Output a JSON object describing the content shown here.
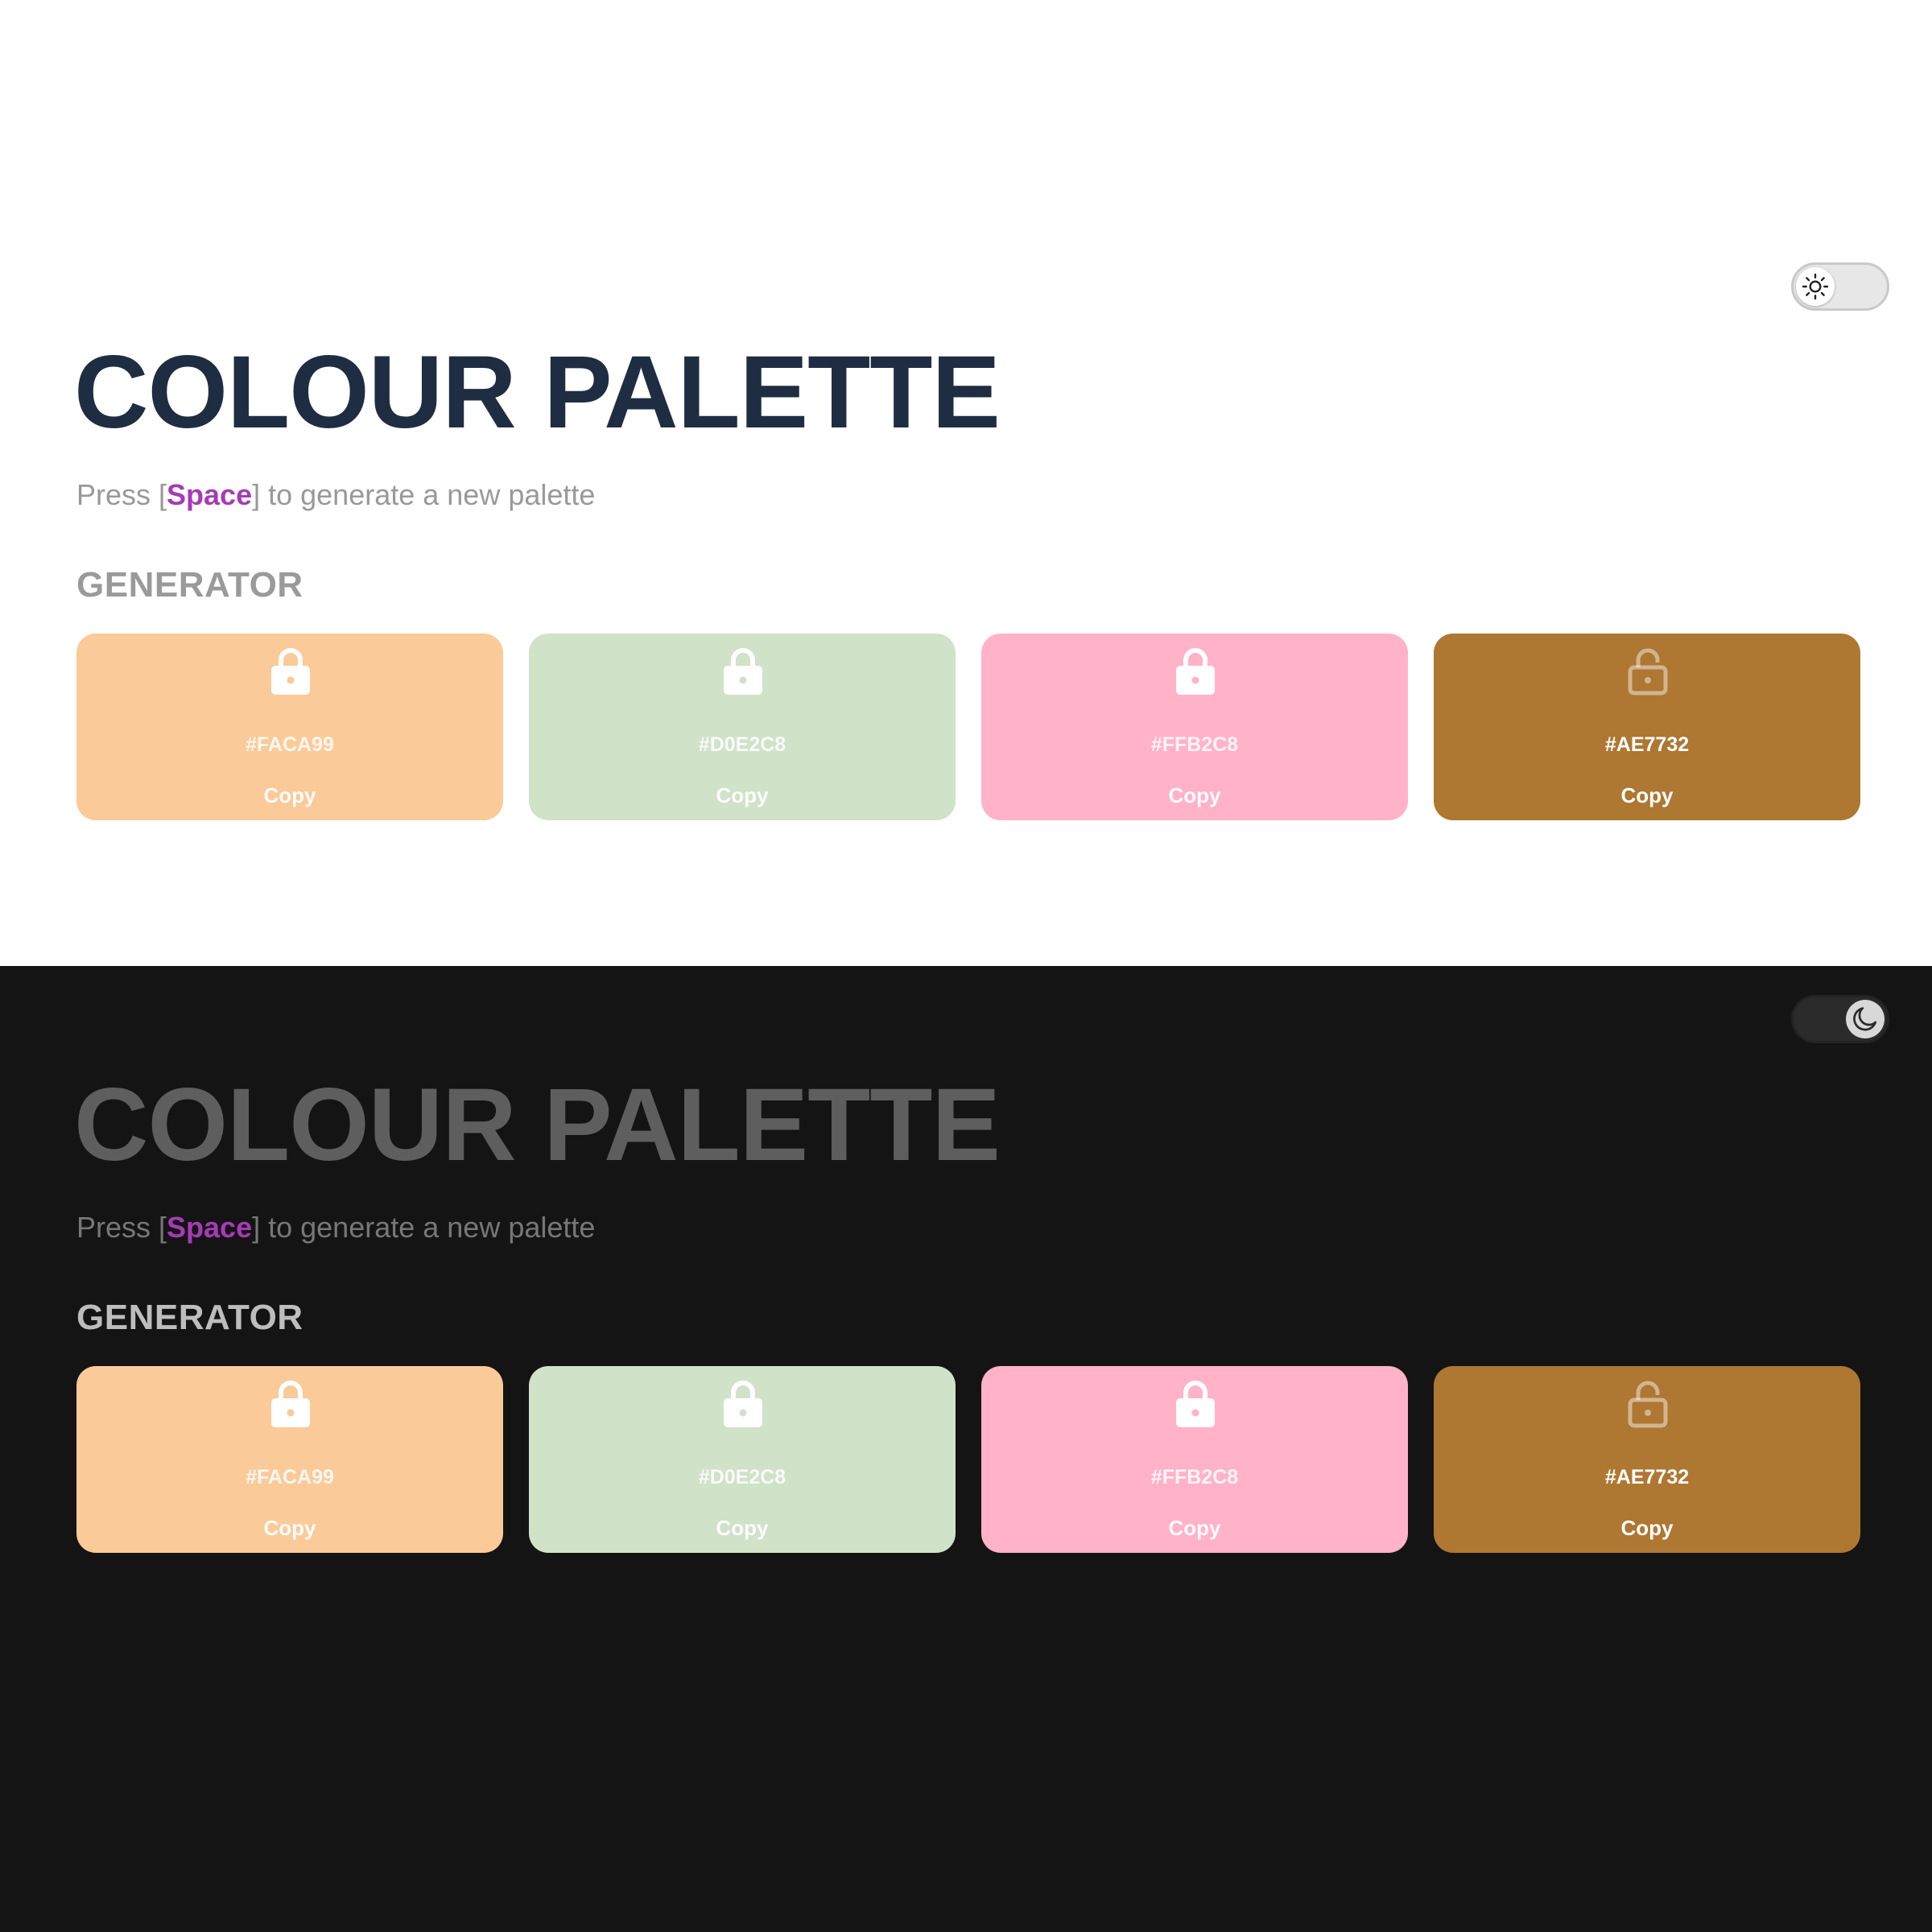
{
  "light": {
    "title": "COLOUR PALETTE",
    "subtitle_prefix": "Press [",
    "subtitle_key": "Space",
    "subtitle_suffix": "] to generate a new palette",
    "section_heading": "GENERATOR",
    "theme_toggle_icon": "sun-icon",
    "swatches": [
      {
        "hex": "#FACA99",
        "copy_label": "Copy",
        "color": "#FACA99",
        "lock_icon": "lock-closed-icon"
      },
      {
        "hex": "#D0E2C8",
        "copy_label": "Copy",
        "color": "#D0E2C8",
        "lock_icon": "lock-closed-icon"
      },
      {
        "hex": "#FFB2C8",
        "copy_label": "Copy",
        "color": "#FFB2C8",
        "lock_icon": "lock-closed-icon"
      },
      {
        "hex": "#AE7732",
        "copy_label": "Copy",
        "color": "#AE7732",
        "lock_icon": "lock-open-icon"
      }
    ]
  },
  "dark": {
    "title": "COLOUR PALETTE",
    "subtitle_prefix": "Press [",
    "subtitle_key": "Space",
    "subtitle_suffix": "] to generate a new palette",
    "section_heading": "GENERATOR",
    "theme_toggle_icon": "moon-icon",
    "swatches": [
      {
        "hex": "#FACA99",
        "copy_label": "Copy",
        "color": "#FACA99",
        "lock_icon": "lock-closed-icon"
      },
      {
        "hex": "#D0E2C8",
        "copy_label": "Copy",
        "color": "#D0E2C8",
        "lock_icon": "lock-closed-icon"
      },
      {
        "hex": "#FFB2C8",
        "copy_label": "Copy",
        "color": "#FFB2C8",
        "lock_icon": "lock-closed-icon"
      },
      {
        "hex": "#AE7732",
        "copy_label": "Copy",
        "color": "#AE7732",
        "lock_icon": "lock-open-icon"
      }
    ]
  },
  "colors": {
    "light_background": "#FFFFFF",
    "dark_background": "#141414",
    "title_light": "#1F2D42",
    "title_dark": "#5E5E5E",
    "key_accent": "#A63BB6"
  }
}
